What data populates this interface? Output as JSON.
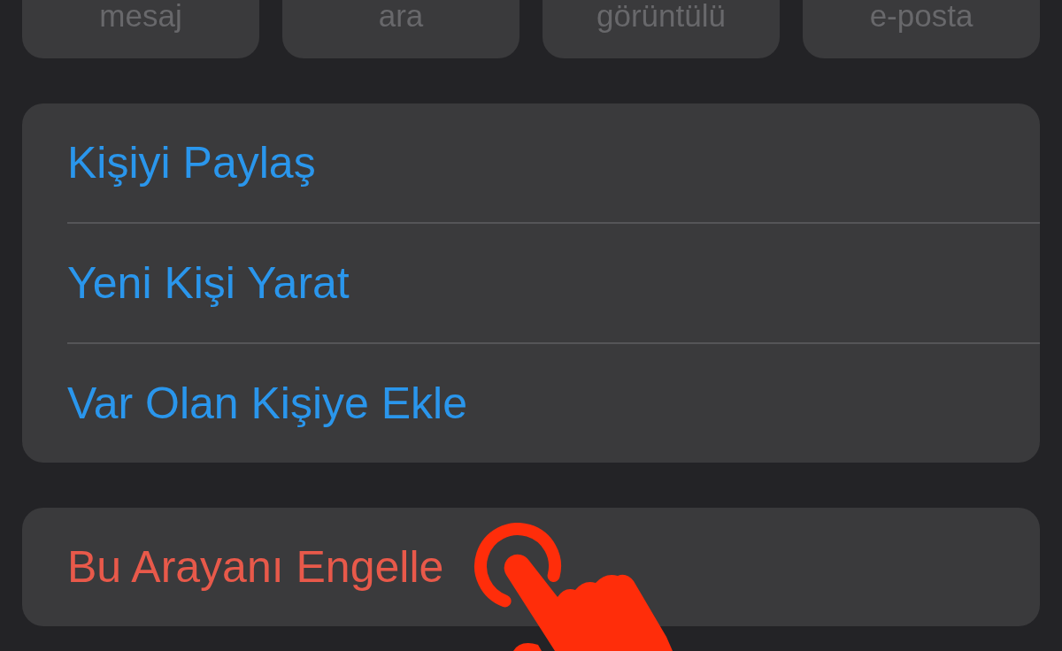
{
  "quick_actions": [
    {
      "label": "mesaj",
      "disabled": true
    },
    {
      "label": "ara",
      "disabled": true
    },
    {
      "label": "görüntülü",
      "disabled": true
    },
    {
      "label": "e-posta",
      "disabled": true
    }
  ],
  "menu_groups": [
    {
      "items": [
        {
          "label": "Kişiyi Paylaş",
          "kind": "action"
        },
        {
          "label": "Yeni Kişi Yarat",
          "kind": "action"
        },
        {
          "label": "Var Olan Kişiye Ekle",
          "kind": "action"
        }
      ]
    },
    {
      "items": [
        {
          "label": "Bu Arayanı Engelle",
          "kind": "destructive"
        }
      ]
    }
  ]
}
